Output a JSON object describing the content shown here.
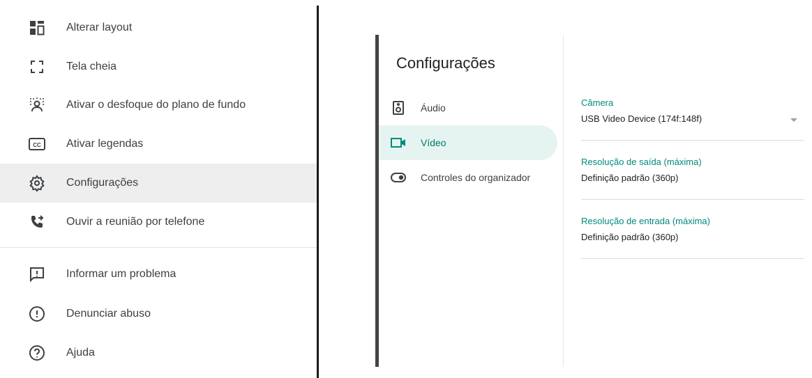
{
  "menu": {
    "items": [
      {
        "label": "Alterar layout",
        "icon": "layout-icon"
      },
      {
        "label": "Tela cheia",
        "icon": "fullscreen-icon"
      },
      {
        "label": "Ativar o desfoque do plano de fundo",
        "icon": "background-blur-icon"
      },
      {
        "label": "Ativar legendas",
        "icon": "closed-captions-icon"
      },
      {
        "label": "Configurações",
        "icon": "gear-icon",
        "active": true
      },
      {
        "label": "Ouvir a reunião por telefone",
        "icon": "phone-forward-icon"
      },
      {
        "label": "Informar um problema",
        "icon": "feedback-icon"
      },
      {
        "label": "Denunciar abuso",
        "icon": "report-icon"
      },
      {
        "label": "Ajuda",
        "icon": "help-icon"
      }
    ]
  },
  "settings": {
    "title": "Configurações",
    "tabs": [
      {
        "label": "Áudio",
        "icon": "speaker-icon"
      },
      {
        "label": "Vídeo",
        "icon": "videocam-icon",
        "active": true
      },
      {
        "label": "Controles do organizador",
        "icon": "toggle-icon"
      }
    ],
    "camera": {
      "label": "Câmera",
      "value": "USB Video Device (174f:148f)"
    },
    "send_resolution": {
      "label": "Resolução de saída (máxima)",
      "value": "Definição padrão (360p)"
    },
    "receive_resolution": {
      "label": "Resolução de entrada (máxima)",
      "value": "Definição padrão (360p)"
    }
  },
  "colors": {
    "accent": "#00897b",
    "active_tab_bg": "#e6f4f1",
    "active_menu_bg": "#eeeeee",
    "text": "#3c4043"
  }
}
